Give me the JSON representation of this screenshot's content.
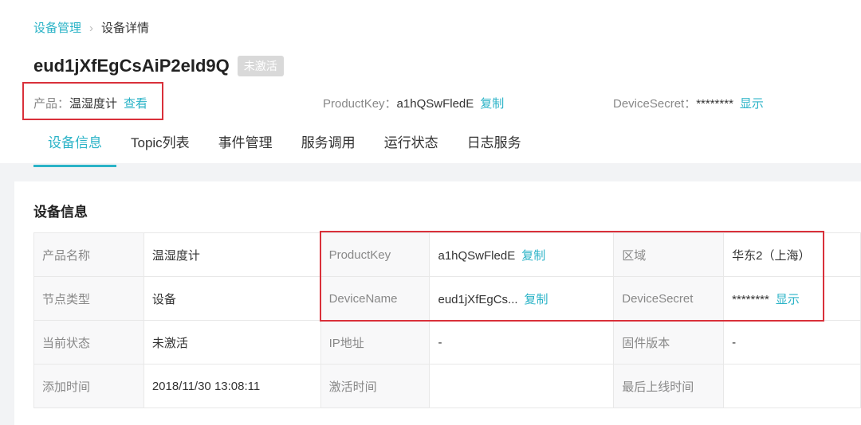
{
  "breadcrumb": {
    "parent": "设备管理",
    "current": "设备详情"
  },
  "device": {
    "name": "eud1jXfEgCsAiP2eId9Q",
    "status": "未激活"
  },
  "meta": {
    "product_label": "产品：",
    "product_value": "温湿度计",
    "product_action": "查看",
    "pk_label": "ProductKey：",
    "pk_value": "a1hQSwFledE",
    "pk_action": "复制",
    "ds_label": "DeviceSecret：",
    "ds_value": "********",
    "ds_action": "显示"
  },
  "tabs": [
    "设备信息",
    "Topic列表",
    "事件管理",
    "服务调用",
    "运行状态",
    "日志服务"
  ],
  "section_title": "设备信息",
  "table": [
    [
      {
        "k": "产品名称"
      },
      {
        "v": "温湿度计"
      },
      {
        "k": "ProductKey"
      },
      {
        "v": "a1hQSwFledE",
        "a": "复制"
      },
      {
        "k": "区域"
      },
      {
        "v": "华东2（上海）"
      }
    ],
    [
      {
        "k": "节点类型"
      },
      {
        "v": "设备"
      },
      {
        "k": "DeviceName"
      },
      {
        "v": "eud1jXfEgCs...",
        "a": "复制"
      },
      {
        "k": "DeviceSecret"
      },
      {
        "v": "********",
        "a": "显示"
      }
    ],
    [
      {
        "k": "当前状态"
      },
      {
        "v": "未激活"
      },
      {
        "k": "IP地址"
      },
      {
        "v": "-"
      },
      {
        "k": "固件版本"
      },
      {
        "v": "-"
      }
    ],
    [
      {
        "k": "添加时间"
      },
      {
        "v": "2018/11/30 13:08:11"
      },
      {
        "k": "激活时间"
      },
      {
        "v": ""
      },
      {
        "k": "最后上线时间"
      },
      {
        "v": ""
      }
    ]
  ],
  "colors": {
    "accent": "#2bb3c7",
    "highlight": "#d9303a"
  }
}
